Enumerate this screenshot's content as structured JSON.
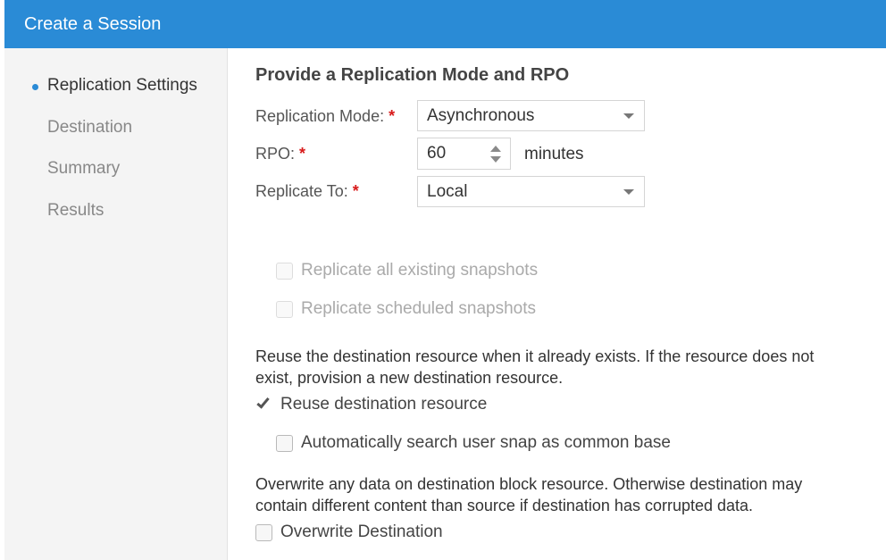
{
  "window": {
    "title": "Create a Session"
  },
  "sidebar": {
    "items": [
      {
        "label": "Replication Settings",
        "active": true
      },
      {
        "label": "Destination",
        "active": false
      },
      {
        "label": "Summary",
        "active": false
      },
      {
        "label": "Results",
        "active": false
      }
    ]
  },
  "form": {
    "heading": "Provide a Replication Mode and RPO",
    "required_marker": "*",
    "replication_mode": {
      "label": "Replication Mode:",
      "value": "Asynchronous"
    },
    "rpo": {
      "label": "RPO:",
      "value": "60",
      "units": "minutes"
    },
    "replicate_to": {
      "label": "Replicate To:",
      "value": "Local"
    },
    "replicate_existing_snapshots": {
      "label": "Replicate all existing snapshots",
      "checked": false,
      "disabled": true
    },
    "replicate_scheduled_snapshots": {
      "label": "Replicate scheduled snapshots",
      "checked": false,
      "disabled": true
    },
    "reuse_description": "Reuse the destination resource when it already exists. If the resource does not exist, provision a new destination resource.",
    "reuse_destination": {
      "label": "Reuse destination resource",
      "checked": true
    },
    "auto_search_snap": {
      "label": "Automatically search user snap as common base",
      "checked": false
    },
    "overwrite_description": "Overwrite any data on destination block resource. Otherwise destination may contain different content than source if destination has corrupted data.",
    "overwrite_destination": {
      "label": "Overwrite Destination",
      "checked": false
    }
  },
  "colors": {
    "accent": "#2a8bd6",
    "required": "#d81b1b"
  }
}
